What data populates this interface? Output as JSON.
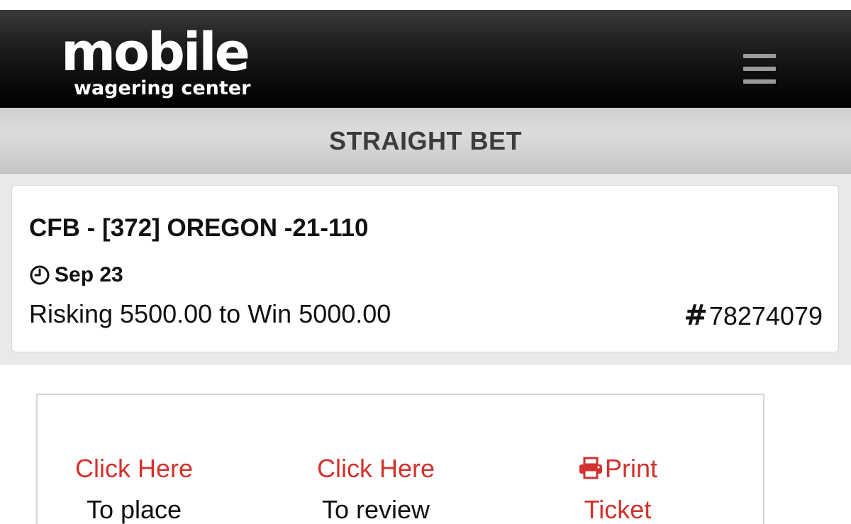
{
  "header": {
    "logo_main": "mobile",
    "logo_sub": "wagering center",
    "menu_icon": "hamburger-menu-icon"
  },
  "subheader": {
    "title": "STRAIGHT BET"
  },
  "bet": {
    "title": "CFB - [372] OREGON -21-110",
    "date": "Sep 23",
    "date_icon": "clock-icon",
    "amount": "Risking 5500.00 to Win 5000.00",
    "ticket_icon": "hash-icon",
    "ticket_number": "78274079"
  },
  "actions": {
    "place": {
      "link": "Click Here",
      "desc": "To place"
    },
    "review": {
      "link": "Click Here",
      "desc": "To review"
    },
    "print": {
      "icon": "print-icon",
      "link": "Print",
      "desc": "Ticket"
    }
  },
  "colors": {
    "header_bg": "#111111",
    "subheader_bg": "#d6d6d6",
    "link_red": "#d2322d",
    "text_dark": "#111111"
  }
}
